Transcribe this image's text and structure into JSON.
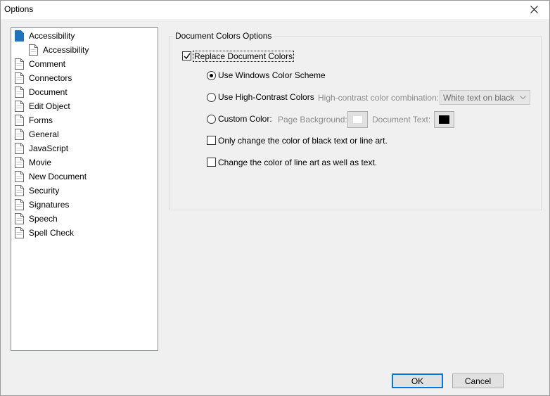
{
  "window": {
    "title": "Options",
    "close_icon": "close-icon"
  },
  "tree": {
    "items": [
      {
        "label": "Accessibility",
        "icon": "page-icon",
        "indent": 0,
        "selected": true
      },
      {
        "label": "Accessibility",
        "icon": "page-icon",
        "indent": 1,
        "selected": false
      },
      {
        "label": "Comment",
        "icon": "page-icon",
        "indent": 0,
        "selected": false
      },
      {
        "label": "Connectors",
        "icon": "page-icon",
        "indent": 0,
        "selected": false
      },
      {
        "label": "Document",
        "icon": "page-icon",
        "indent": 0,
        "selected": false
      },
      {
        "label": "Edit Object",
        "icon": "page-icon",
        "indent": 0,
        "selected": false
      },
      {
        "label": "Forms",
        "icon": "page-icon",
        "indent": 0,
        "selected": false
      },
      {
        "label": "General",
        "icon": "page-icon",
        "indent": 0,
        "selected": false
      },
      {
        "label": "JavaScript",
        "icon": "page-icon",
        "indent": 0,
        "selected": false
      },
      {
        "label": "Movie",
        "icon": "page-icon",
        "indent": 0,
        "selected": false
      },
      {
        "label": "New Document",
        "icon": "page-icon",
        "indent": 0,
        "selected": false
      },
      {
        "label": "Security",
        "icon": "page-icon",
        "indent": 0,
        "selected": false
      },
      {
        "label": "Signatures",
        "icon": "page-icon",
        "indent": 0,
        "selected": false
      },
      {
        "label": "Speech",
        "icon": "page-icon",
        "indent": 0,
        "selected": false
      },
      {
        "label": "Spell Check",
        "icon": "page-icon",
        "indent": 0,
        "selected": false
      }
    ]
  },
  "panel": {
    "group_title": "Document Colors Options",
    "replace_colors": {
      "label": "Replace Document Colors",
      "checked": true
    },
    "radio_windows": {
      "label": "Use Windows Color Scheme",
      "checked": true
    },
    "radio_high_contrast": {
      "label": "Use High-Contrast Colors",
      "checked": false
    },
    "high_contrast_label": "High-contrast color combination:",
    "high_contrast_select": {
      "value": "White text on black"
    },
    "radio_custom": {
      "label": "Custom Color:",
      "checked": false
    },
    "page_background_label": "Page Background:",
    "page_background_color": "#ffffff",
    "document_text_label": "Document Text:",
    "document_text_color": "#000000",
    "only_black_text": {
      "label": "Only change the color of black text or line art.",
      "checked": false
    },
    "line_art_too": {
      "label": "Change the color of line art as well as text.",
      "checked": false
    }
  },
  "footer": {
    "ok_label": "OK",
    "cancel_label": "Cancel"
  },
  "colors": {
    "accent": "#0078d7",
    "selected_icon": "#1e73be"
  }
}
